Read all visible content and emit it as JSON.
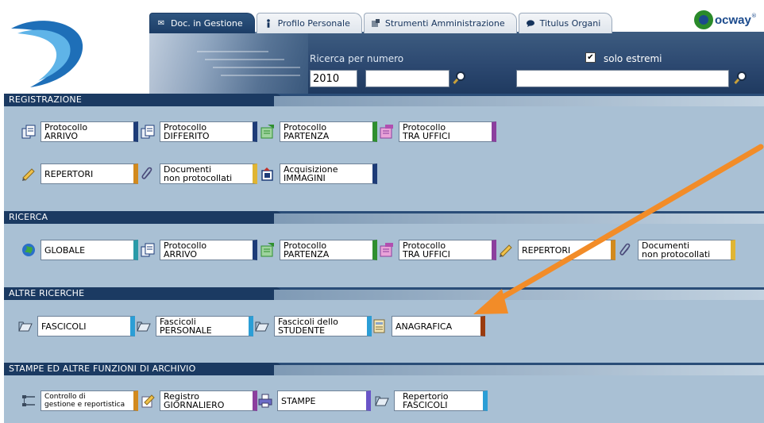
{
  "tabs": [
    {
      "label": "Doc. in Gestione",
      "icon": "envelope-icon",
      "active": true
    },
    {
      "label": "Profilo Personale",
      "icon": "person-icon",
      "active": false
    },
    {
      "label": "Strumenti Amministrazione",
      "icon": "tools-icon",
      "active": false
    },
    {
      "label": "Titulus Organi",
      "icon": "speech-icon",
      "active": false
    }
  ],
  "brand": {
    "text": "ocway",
    "suffix": "®"
  },
  "search": {
    "label": "Ricerca per numero",
    "year_value": "2010",
    "number_value": "",
    "solo_estremi_label": "solo estremi",
    "solo_estremi_checked": true,
    "free_text_value": ""
  },
  "sections": {
    "registrazione": {
      "title": "REGISTRAZIONE",
      "buttons": [
        "Protocollo\nARRIVO",
        "Protocollo\nDIFFERITO",
        "Protocollo\nPARTENZA",
        "Protocollo\nTRA UFFICI",
        "REPERTORI",
        "Documenti\nnon protocollati",
        "Acquisizione\nIMMAGINI"
      ]
    },
    "ricerca": {
      "title": "RICERCA",
      "buttons": [
        "GLOBALE",
        "Protocollo\nARRIVO",
        "Protocollo\nPARTENZA",
        "Protocollo\nTRA UFFICI",
        "REPERTORI",
        "Documenti\nnon protocollati"
      ]
    },
    "altre": {
      "title": "ALTRE RICERCHE",
      "buttons": [
        "FASCICOLI",
        "Fascicoli\nPERSONALE",
        "Fascicoli dello\nSTUDENTE",
        "ANAGRAFICA"
      ]
    },
    "stampe": {
      "title": "STAMPE ED ALTRE FUNZIONI DI ARCHIVIO",
      "buttons": [
        "Controllo di\ngestione e reportistica",
        "Registro\nGIORNALIERO",
        "STAMPE",
        "Repertorio\nFASCICOLI"
      ]
    }
  },
  "colors": {
    "accent_arrow": "#f28c28",
    "section_bg": "#a9c0d4",
    "title_bar": "#1b3a62"
  }
}
